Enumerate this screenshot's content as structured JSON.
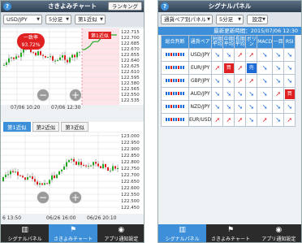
{
  "left": {
    "title": "さきよみチャート",
    "help": "?",
    "ranking": "ランキング",
    "pair": "USD/JPY",
    "timeframe": "5分足",
    "type": "第1近似",
    "top_chart": {
      "y_ticks": [
        "122.715",
        "122.700",
        "122.685",
        "122.670",
        "122.655",
        "122.640",
        "122.625",
        "122.610",
        "122.595",
        "122.580",
        "122.565",
        "122.550",
        "122.535"
      ],
      "x_labels": [
        "07/06 10:20",
        "07/06 12:30"
      ],
      "left_label": "一致率 93.72%",
      "right_label": "第1近似"
    },
    "tabs": [
      "第1近似",
      "第2近似",
      "第3近似"
    ],
    "bottom_chart": {
      "y_ticks": [
        "123.000",
        "122.950",
        "122.900",
        "122.850",
        "122.800",
        "122.750",
        "122.700",
        "122.650",
        "122.600",
        "122.550",
        "122.500",
        "122.450"
      ],
      "x_labels": [
        "6 13:50",
        "06/26 16:00",
        "06/26 20:10"
      ]
    },
    "nav": [
      {
        "icon": "bar-chart-icon",
        "label": "シグナルパネル"
      },
      {
        "icon": "chart-icon",
        "label": "さきよみチャート"
      },
      {
        "icon": "broadcast-icon",
        "label": "アプリ通知設定"
      }
    ],
    "active_nav": 1
  },
  "right": {
    "title": "シグナルパネル",
    "help": "?",
    "mode": "通貨ペア別パネル",
    "timeframe": "5分足",
    "settings": "設定",
    "updated": "最新更新時間：2015/07/06 12:30",
    "header": [
      "総合判断",
      "通貨ペア",
      "短期平均",
      "中期平均",
      "長期平均",
      "ボリン",
      "MACD",
      "一目",
      "RSI"
    ],
    "rows": [
      {
        "pair": "USD/JPY",
        "signals": [
          "up",
          "up",
          "down",
          "down",
          "up",
          "up",
          "up"
        ]
      },
      {
        "pair": "EUR/JPY",
        "signals": [
          "down",
          "buy",
          "down",
          "sell",
          "up",
          "up",
          "up"
        ]
      },
      {
        "pair": "GBP/JPY",
        "signals": [
          "up",
          "up",
          "down",
          "down",
          "up",
          "up",
          "up"
        ]
      },
      {
        "pair": "AUD/JPY",
        "signals": [
          "up",
          "up",
          "up",
          "up",
          "up",
          "down",
          "buy"
        ]
      },
      {
        "pair": "NZD/JPY",
        "signals": [
          "up",
          "up",
          "up",
          "up",
          "up",
          "up",
          "up"
        ]
      },
      {
        "pair": "EUR/USD",
        "signals": [
          "down",
          "down",
          "down",
          "up",
          "down",
          "up",
          "down"
        ]
      }
    ],
    "buy_label": "買",
    "sell_label": "売",
    "nav": [
      {
        "icon": "bar-chart-icon",
        "label": "シグナルパネル"
      },
      {
        "icon": "chart-icon",
        "label": "さきよみチャート"
      },
      {
        "icon": "broadcast-icon",
        "label": "アプリ通知設定"
      }
    ],
    "active_nav": 0
  },
  "colors": {
    "accent": "#3c8fd8",
    "up": "#1e6ad6",
    "down": "#e02020",
    "green": "#22aa22"
  }
}
